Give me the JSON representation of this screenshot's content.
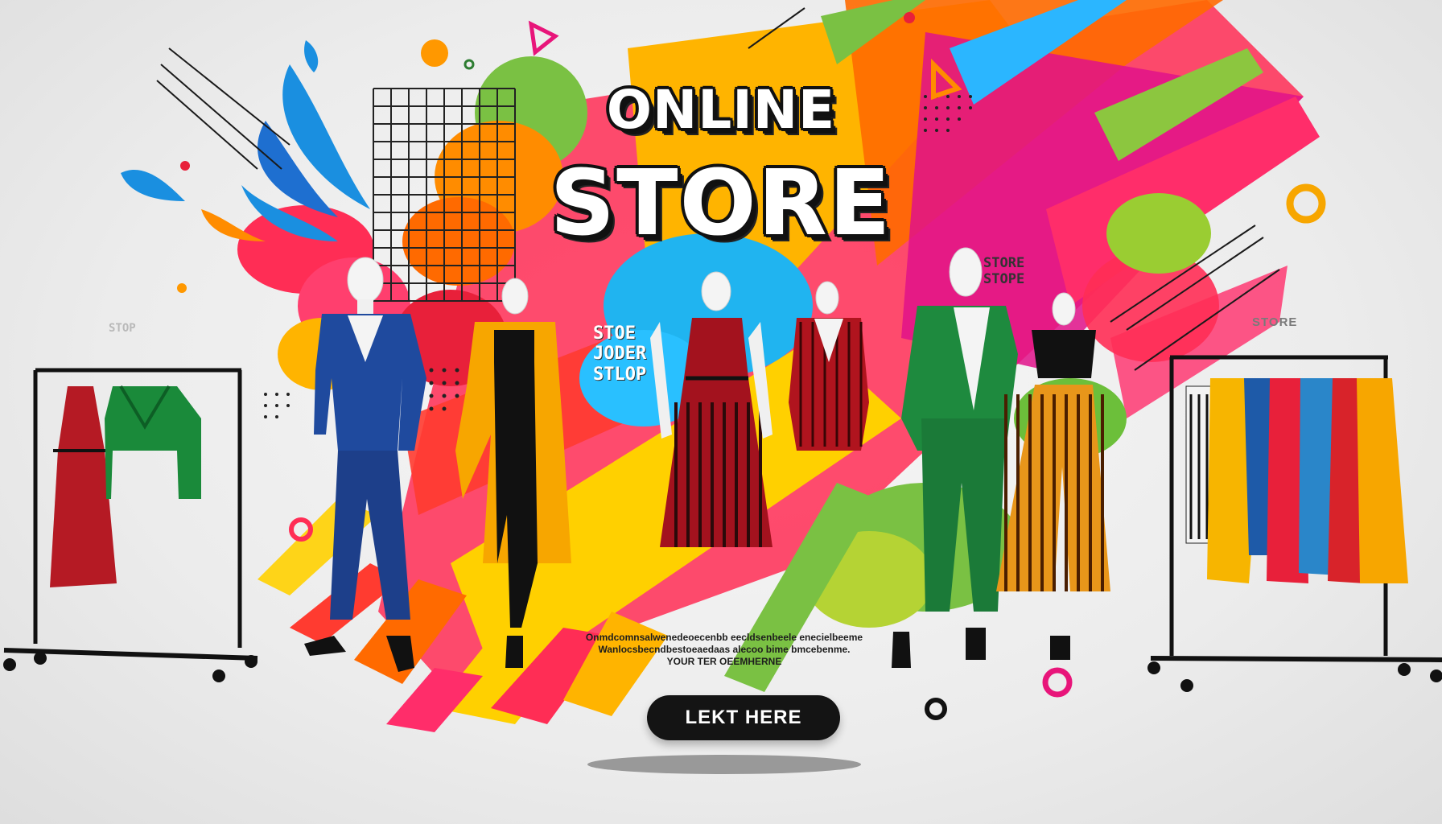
{
  "hero": {
    "title_top": "ONLINE",
    "title_main": "STORE"
  },
  "tags": {
    "left": "STOP",
    "center_lines": [
      "STOE",
      "JODER",
      "STLOP"
    ],
    "right_top_lines": [
      "STORE",
      "STOPE"
    ],
    "right": "STORE"
  },
  "tagline": {
    "lines": [
      "Onmdcomnsalwenedeoecenbb eecldsenbeele enecielbeeme",
      "Wanlocsbecndbestoeaedaas alecoo bime bmcebenme.",
      "YOUR TER OEEMHERNE"
    ]
  },
  "cta": {
    "label": "LEKT HERE"
  },
  "colors": {
    "background": "#ececec",
    "button": "#141414",
    "accent_red": "#e8203a",
    "accent_yellow": "#f7b500",
    "accent_blue": "#1a8fe0",
    "accent_green": "#7ac143",
    "accent_magenta": "#e8157a"
  }
}
